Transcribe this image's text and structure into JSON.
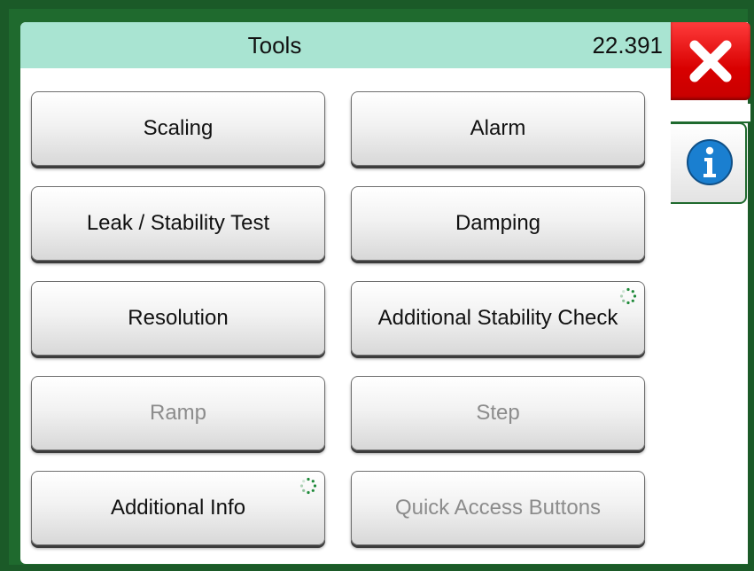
{
  "header": {
    "title": "Tools",
    "value": "22.391"
  },
  "side_tabs": {
    "close_icon": "close-icon",
    "info_icon": "info-icon",
    "close_color": "#e00000",
    "info_color": "#1a7fd0"
  },
  "buttons": [
    {
      "label": "Scaling",
      "enabled": true,
      "busy": false
    },
    {
      "label": "Alarm",
      "enabled": true,
      "busy": false
    },
    {
      "label": "Leak / Stability Test",
      "enabled": true,
      "busy": false
    },
    {
      "label": "Damping",
      "enabled": true,
      "busy": false
    },
    {
      "label": "Resolution",
      "enabled": true,
      "busy": false
    },
    {
      "label": "Additional Stability Check",
      "enabled": true,
      "busy": true
    },
    {
      "label": "Ramp",
      "enabled": false,
      "busy": false
    },
    {
      "label": "Step",
      "enabled": false,
      "busy": false
    },
    {
      "label": "Additional Info",
      "enabled": true,
      "busy": true
    },
    {
      "label": "Quick Access Buttons",
      "enabled": false,
      "busy": false
    }
  ],
  "colors": {
    "frame": "#1f6a2e",
    "header": "#a9e4d2",
    "spinner": "#1f8a3a"
  }
}
